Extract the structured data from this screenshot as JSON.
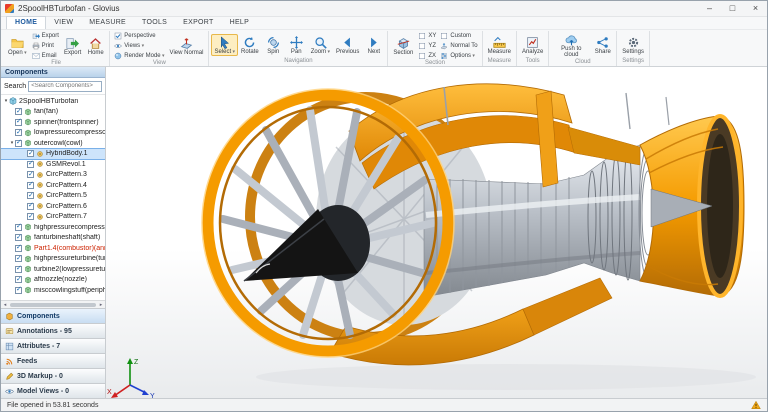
{
  "window": {
    "title": "2SpoolHBTurbofan - Glovius",
    "controls": [
      {
        "name": "minimize",
        "glyph": "–"
      },
      {
        "name": "maximize",
        "glyph": "□"
      },
      {
        "name": "close",
        "glyph": "×"
      }
    ]
  },
  "menu": {
    "tabs": [
      {
        "label": "HOME",
        "active": true
      },
      {
        "label": "VIEW"
      },
      {
        "label": "MEASURE"
      },
      {
        "label": "TOOLS"
      },
      {
        "label": "EXPORT"
      },
      {
        "label": "HELP"
      }
    ]
  },
  "ribbon": {
    "groups": [
      {
        "label": "File",
        "columns": [
          {
            "type": "large",
            "label": "Open",
            "icon": "folder",
            "dropdown": true
          },
          {
            "type": "stack",
            "items": [
              {
                "label": "Export",
                "icon": "export"
              },
              {
                "label": "Print",
                "icon": "print"
              },
              {
                "label": "Email",
                "icon": "email"
              }
            ]
          },
          {
            "type": "large",
            "label": "Export",
            "icon": "export2"
          },
          {
            "type": "large",
            "label": "Home",
            "icon": "home"
          }
        ]
      },
      {
        "label": "View",
        "columns": [
          {
            "type": "stack",
            "items": [
              {
                "label": "Perspective",
                "icon": "perspective"
              },
              {
                "label": "Views",
                "icon": "views",
                "dropdown": true
              },
              {
                "label": "Render Mode",
                "icon": "render",
                "dropdown": true
              }
            ]
          },
          {
            "type": "large",
            "label": "View Normal",
            "icon": "viewnormal"
          }
        ]
      },
      {
        "label": "Navigation",
        "columns": [
          {
            "type": "large",
            "label": "Select",
            "icon": "cursor",
            "active": true,
            "dropdown": true
          },
          {
            "type": "large",
            "label": "Rotate",
            "icon": "rotate"
          },
          {
            "type": "large",
            "label": "Spin",
            "icon": "spin"
          },
          {
            "type": "large",
            "label": "Pan",
            "icon": "pan"
          },
          {
            "type": "large",
            "label": "Zoom",
            "icon": "zoom",
            "dropdown": true
          },
          {
            "type": "large",
            "label": "Previous",
            "icon": "prev"
          },
          {
            "type": "large",
            "label": "Next",
            "icon": "next"
          }
        ]
      },
      {
        "label": "Section",
        "columns": [
          {
            "type": "large",
            "label": "Section",
            "icon": "section"
          },
          {
            "type": "stack",
            "items": [
              {
                "label": "XY",
                "icon": "checkbox"
              },
              {
                "label": "YZ",
                "icon": "checkbox"
              },
              {
                "label": "ZX",
                "icon": "checkbox"
              }
            ]
          },
          {
            "type": "stack",
            "items": [
              {
                "label": "Custom",
                "icon": "checkbox"
              },
              {
                "label": "Normal To",
                "icon": "normalto"
              },
              {
                "label": "Options",
                "icon": "options",
                "dropdown": true
              }
            ]
          }
        ]
      },
      {
        "label": "Measure",
        "columns": [
          {
            "type": "large",
            "label": "Measure",
            "icon": "measure"
          }
        ]
      },
      {
        "label": "Tools",
        "columns": [
          {
            "type": "large",
            "label": "Analyze",
            "icon": "analyze"
          }
        ]
      },
      {
        "label": "Cloud",
        "columns": [
          {
            "type": "large",
            "label": "Push to cloud",
            "icon": "cloud"
          },
          {
            "type": "large",
            "label": "Share",
            "icon": "share"
          }
        ]
      },
      {
        "label": "Settings",
        "columns": [
          {
            "type": "large",
            "label": "Settings",
            "icon": "settings"
          }
        ]
      }
    ]
  },
  "sidebar": {
    "header": "Components",
    "search_label": "Search",
    "search_placeholder": "<Search Components>",
    "tree": [
      {
        "label": "2SpoolHBTurbofan",
        "level": 0,
        "icon": "asm",
        "expanded": true,
        "checkbox": false
      },
      {
        "label": "fan(fan)",
        "level": 1,
        "icon": "part",
        "checked": true
      },
      {
        "label": "spinner(frontspinner)",
        "level": 1,
        "icon": "part",
        "checked": true
      },
      {
        "label": "lowpressurecompressor...",
        "level": 1,
        "icon": "part",
        "checked": true
      },
      {
        "label": "outercowl(cowl)",
        "level": 1,
        "icon": "part",
        "checked": true,
        "expanded": true
      },
      {
        "label": "HybridBody.1",
        "level": 2,
        "icon": "feature",
        "checked": true,
        "selected": true
      },
      {
        "label": "GSMRevol.1",
        "level": 2,
        "icon": "feature",
        "checked": true
      },
      {
        "label": "CircPattern.3",
        "level": 2,
        "icon": "feature",
        "checked": true
      },
      {
        "label": "CircPattern.4",
        "level": 2,
        "icon": "feature",
        "checked": true
      },
      {
        "label": "CircPattern.5",
        "level": 2,
        "icon": "feature",
        "checked": true
      },
      {
        "label": "CircPattern.6",
        "level": 2,
        "icon": "feature",
        "checked": true
      },
      {
        "label": "CircPattern.7",
        "level": 2,
        "icon": "feature",
        "checked": true
      },
      {
        "label": "highpressurecompressor...",
        "level": 1,
        "icon": "part",
        "checked": true
      },
      {
        "label": "fanturbineshaft(shaft)",
        "level": 1,
        "icon": "part",
        "checked": true
      },
      {
        "label": "Part1.4(combustor)(ann...",
        "level": 1,
        "icon": "part",
        "checked": true,
        "color": "#cc2200"
      },
      {
        "label": "highpressureturbine(tur...",
        "level": 1,
        "icon": "part",
        "checked": true
      },
      {
        "label": "turbine2(lowpressuretur...",
        "level": 1,
        "icon": "part",
        "checked": true
      },
      {
        "label": "aftnozzle(nozzle)",
        "level": 1,
        "icon": "part",
        "checked": true
      },
      {
        "label": "misccowlingstuff(periph...",
        "level": 1,
        "icon": "part",
        "checked": true
      }
    ],
    "panels": [
      {
        "label": "Components",
        "icon": "components",
        "active": true
      },
      {
        "label": "Annotations - 95",
        "icon": "annotations"
      },
      {
        "label": "Attributes - 7",
        "icon": "attributes"
      },
      {
        "label": "Feeds",
        "icon": "feeds"
      },
      {
        "label": "3D Markup - 0",
        "icon": "markup"
      },
      {
        "label": "Model Views - 0",
        "icon": "views"
      }
    ]
  },
  "viewport": {
    "triad": {
      "up": "Z",
      "left": "X",
      "right": "Y"
    }
  },
  "statusbar": {
    "message": "File opened in 53.81 seconds"
  },
  "colors": {
    "engine_orange": "#F59B00",
    "engine_gray": "#B5BAC2",
    "selection_blue": "#CDE4FB",
    "accent_blue": "#2F7CC0",
    "warning_orange": "#E8A000"
  }
}
